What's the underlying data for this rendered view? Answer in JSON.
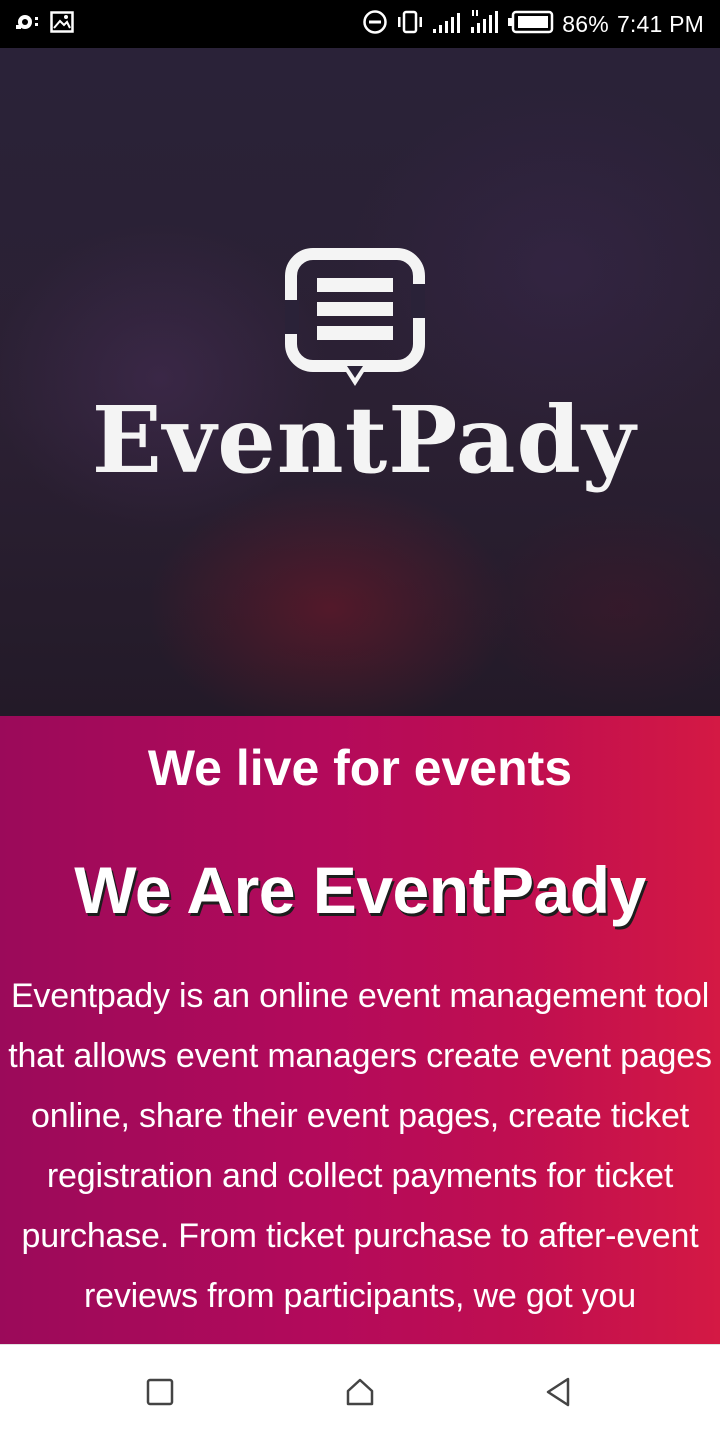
{
  "status_bar": {
    "icons_left": [
      "eye-icon",
      "image-icon"
    ],
    "icons_right": [
      "do-not-disturb-icon",
      "vibrate-icon",
      "signal-icon",
      "signal-4g-icon",
      "battery-icon"
    ],
    "battery": "86%",
    "time": "7:41 PM"
  },
  "hero": {
    "logo_text": "EventPady",
    "logo_icon": "event-board-icon"
  },
  "content": {
    "tagline": "We live for events",
    "headline": "We Are EventPady",
    "description": "Eventpady is an online event management tool that allows event managers create event pages online, share their event pages, create ticket registration and collect payments for ticket purchase. From ticket purchase to after-event reviews from participants, we got you"
  },
  "nav_bar": {
    "icons": [
      "recent-apps-icon",
      "home-icon",
      "back-icon"
    ]
  },
  "colors": {
    "gradient_start": "#9b0a5a",
    "gradient_end": "#d41944",
    "hero_dark": "#2a2238"
  }
}
